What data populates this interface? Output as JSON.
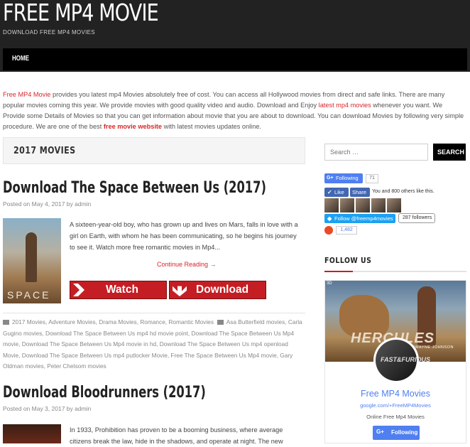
{
  "site": {
    "title": "FREE MP4 MOVIE",
    "tagline": "DOWNLOAD FREE MP4 MOVIES"
  },
  "nav": {
    "home": "HOME"
  },
  "intro": {
    "link1": "Free MP4 Movie",
    "text1": " provides you latest mp4 Movies absolutely free of cost. You can access all Hollywood movies from direct and safe links. There are many popular movies coming this year. We provide movies with good quality video and audio. Download and Enjoy ",
    "link2": "latest mp4 movies",
    "text2": " whenever you want. We Provide some Details of Movies so that you can get information about movie that you are about to download. You can download Movies by following very simple procedure. We are one of the best ",
    "link3": "free movie website",
    "text3": " with latest movies updates online."
  },
  "category": {
    "title": "2017 MOVIES"
  },
  "posts": [
    {
      "title": "Download The Space Between Us (2017)",
      "meta": "Posted on May 4, 2017 by admin",
      "poster_text": "SPACE",
      "excerpt": "A sixteen-year-old boy, who has grown up and lives on Mars, falls in love with a girl on Earth, with whom he has been communicating, so he begins his journey to see it. Watch more free romantic movies in Mp4...",
      "continue": "Continue Reading →",
      "watch_label": "Watch",
      "download_label": "Download",
      "tags": "2017 Movies, Adventure Movies, Drama Movies, Romance, Romantic Movies",
      "tags2": "Asa Butterfield movies, Carla Gugino movies, Download The Space Between Us mp4 hd movie point, Download The Space Between Us Mp4 movie, Download The Space Between Us Mp4 movie in hd, Download The Space Between Us mp4 openload Movie, Download The Space Between Us mp4 putlocker Movie, Free The Space Between Us Mp4 movie, Gary Oldman movies, Peter Chelsom movies"
    },
    {
      "title": "Download Bloodrunners (2017)",
      "meta": "Posted on May 3, 2017 by admin",
      "excerpt": "In 1933, Prohibition has proven to be a booming business, where average citizens break the law, hide in the shadows, and operate at night. The new"
    }
  ],
  "sidebar": {
    "search_placeholder": "Search …",
    "search_button": "SEARCH",
    "gplus_following": "Following",
    "gplus_count": "71",
    "fb_like": "Like",
    "fb_share": "Share",
    "fb_text": "You and 800 others like this.",
    "tw_follow": "Follow @freemp4movies",
    "tw_count": "287 followers",
    "su_count": "1,482",
    "follow_title": "FOLLOW US",
    "card": {
      "cover_title": "HERCULES",
      "cover_actor": "DWAYNE JOHNSON",
      "cover_3d": "3D",
      "avatar_text": "FAST&FURIOUS",
      "name": "Free MP4 Movies",
      "url": "google.com/+FreeMP4Movies",
      "desc": "Online Free Mp4 Movies",
      "follow": "Following"
    }
  },
  "colors": {
    "accent": "#d9262b",
    "dark": "#222222",
    "gplus": "#4f7ff0",
    "facebook": "#4267b2",
    "twitter": "#1da1f2"
  }
}
